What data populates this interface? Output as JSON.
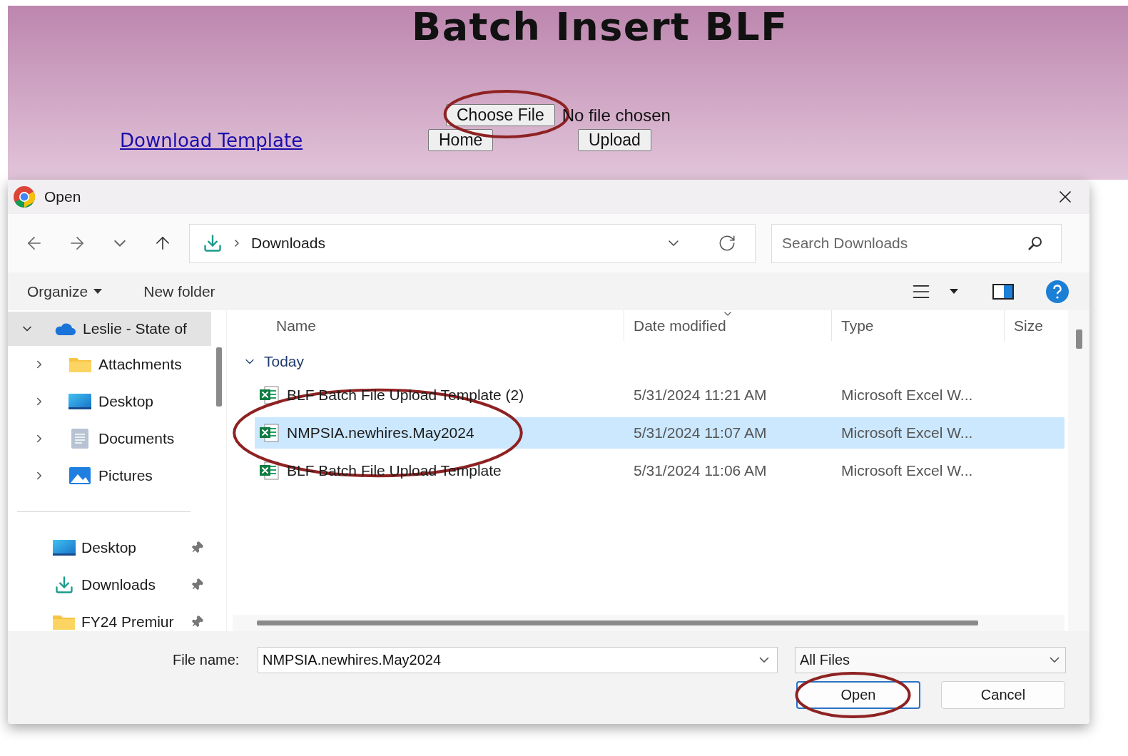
{
  "page": {
    "title": "Batch Insert BLF",
    "file_input": {
      "button": "Choose File",
      "status": "No file chosen",
      "circled": true
    },
    "link": "Download Template",
    "buttons": [
      "Home",
      "Upload"
    ]
  },
  "dialog": {
    "title": "Open",
    "address": {
      "path": "Downloads"
    },
    "search": {
      "placeholder": "Search Downloads"
    },
    "commands": [
      {
        "label": "Organize",
        "dropdown": true
      },
      {
        "label": "New folder",
        "dropdown": false
      }
    ],
    "sidebar": {
      "items": [
        {
          "label": "Leslie - State of",
          "kind": "cloud",
          "expanded": true,
          "selected": true,
          "children": [
            {
              "label": "Attachments",
              "kind": "folder",
              "expanded": false,
              "selected": false
            },
            {
              "label": "Desktop",
              "kind": "desktop",
              "expanded": false,
              "selected": false
            },
            {
              "label": "Documents",
              "kind": "documents",
              "expanded": false,
              "selected": false
            },
            {
              "label": "Pictures",
              "kind": "pictures",
              "expanded": false,
              "selected": false
            }
          ]
        }
      ],
      "quick_access": [
        {
          "label": "Desktop",
          "kind": "desktop",
          "pinned": true
        },
        {
          "label": "Downloads",
          "kind": "downloads",
          "pinned": true
        },
        {
          "label": "FY24 Premiur",
          "kind": "folder",
          "pinned": true
        }
      ]
    },
    "columns": [
      "Name",
      "Date modified",
      "Type",
      "Size"
    ],
    "groups": [
      {
        "label": "Today",
        "expanded": true,
        "files": [
          {
            "name": "BLF Batch File Upload Template (2)",
            "date": "5/31/2024 11:21 AM",
            "type": "Microsoft Excel W...",
            "selected": false,
            "circled": false
          },
          {
            "name": "NMPSIA.newhires.May2024",
            "date": "5/31/2024 11:07 AM",
            "type": "Microsoft Excel W...",
            "selected": true,
            "circled": true
          },
          {
            "name": "BLF Batch File Upload Template",
            "date": "5/31/2024 11:06 AM",
            "type": "Microsoft Excel W...",
            "selected": false,
            "circled": false
          }
        ]
      }
    ],
    "file_name": {
      "label": "File name:",
      "value": "NMPSIA.newhires.May2024"
    },
    "filter": {
      "value": "All Files"
    },
    "buttons": [
      {
        "label": "Open",
        "primary": true,
        "circled": true
      },
      {
        "label": "Cancel",
        "primary": false,
        "circled": false
      }
    ]
  }
}
